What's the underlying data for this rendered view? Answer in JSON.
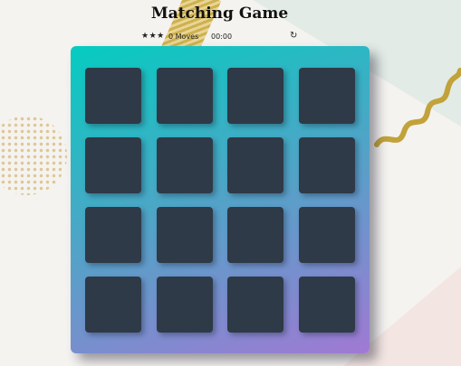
{
  "header": {
    "title": "Matching Game"
  },
  "score_panel": {
    "stars": "★★★",
    "star_rating": 3,
    "moves_count": "0",
    "moves_label": "Moves",
    "timer": "00:00",
    "restart_icon": "↻"
  },
  "deck": {
    "rows": 4,
    "columns": 4,
    "cards": [
      {
        "state": "face-down"
      },
      {
        "state": "face-down"
      },
      {
        "state": "face-down"
      },
      {
        "state": "face-down"
      },
      {
        "state": "face-down"
      },
      {
        "state": "face-down"
      },
      {
        "state": "face-down"
      },
      {
        "state": "face-down"
      },
      {
        "state": "face-down"
      },
      {
        "state": "face-down"
      },
      {
        "state": "face-down"
      },
      {
        "state": "face-down"
      },
      {
        "state": "face-down"
      },
      {
        "state": "face-down"
      },
      {
        "state": "face-down"
      },
      {
        "state": "face-down"
      }
    ]
  },
  "colors": {
    "deck_gradient_start": "#05ccc0",
    "deck_gradient_end": "#a179d4",
    "card_back": "#2e3a47"
  }
}
